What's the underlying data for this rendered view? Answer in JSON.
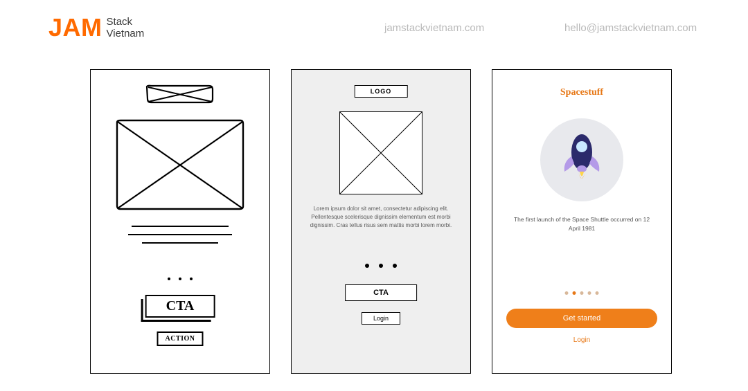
{
  "header": {
    "logo_jam": "JAM",
    "logo_stack": "Stack",
    "logo_vietnam": "Vietnam",
    "site": "jamstackvietnam.com",
    "email": "hello@jamstackvietnam.com"
  },
  "sketch": {
    "cta": "CTA",
    "action": "ACTION"
  },
  "wireframe": {
    "logo": "LOGO",
    "lorem": "Lorem ipsum dolor sit amet, consectetur adipiscing elit. Pellentesque scelerisque dignissim elementum est morbi dignissim. Cras tellus risus sem mattis morbi lorem morbi.",
    "cta": "CTA",
    "login": "Login"
  },
  "hifi": {
    "title": "Spacestuff",
    "desc": "The first launch of the Space Shuttle occurred on 12 April 1981",
    "cta": "Get started",
    "login": "Login"
  }
}
